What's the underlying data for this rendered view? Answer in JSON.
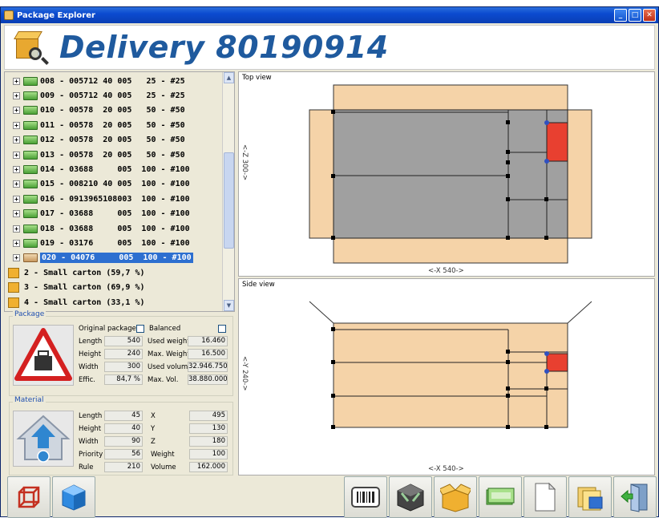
{
  "window": {
    "title": "Package Explorer"
  },
  "header": {
    "title": "Delivery 80190914"
  },
  "tree": {
    "items": [
      {
        "label": "008 - 005712 40 005   25 - #25",
        "kind": "bill"
      },
      {
        "label": "009 - 005712 40 005   25 - #25",
        "kind": "bill"
      },
      {
        "label": "010 - 00578  20 005   50 - #50",
        "kind": "bill"
      },
      {
        "label": "011 - 00578  20 005   50 - #50",
        "kind": "bill"
      },
      {
        "label": "012 - 00578  20 005   50 - #50",
        "kind": "bill"
      },
      {
        "label": "013 - 00578  20 005   50 - #50",
        "kind": "bill"
      },
      {
        "label": "014 - 03688     005  100 - #100",
        "kind": "bill"
      },
      {
        "label": "015 - 008210 40 005  100 - #100",
        "kind": "bill"
      },
      {
        "label": "016 - 0913965108003  100 - #100",
        "kind": "bill"
      },
      {
        "label": "017 - 03688     005  100 - #100",
        "kind": "bill"
      },
      {
        "label": "018 - 03688     005  100 - #100",
        "kind": "bill"
      },
      {
        "label": "019 - 03176     005  100 - #100",
        "kind": "bill"
      },
      {
        "label": "020 - 04076     005  100 - #100",
        "kind": "selected"
      },
      {
        "label": "2 - Small carton (59,7 %)",
        "kind": "carton"
      },
      {
        "label": "3 - Small carton (69,9 %)",
        "kind": "carton"
      },
      {
        "label": "4 - Small carton (33,1 %)",
        "kind": "carton"
      }
    ]
  },
  "package": {
    "group_label": "Package",
    "original_package_label": "Original package",
    "balanced_label": "Balanced",
    "length_label": "Length",
    "length": "540",
    "height_label": "Height",
    "height": "240",
    "width_label": "Width",
    "width": "300",
    "effic_label": "Effic.",
    "effic": "84,7 %",
    "used_weight_label": "Used weight",
    "used_weight": "16.460",
    "max_weight_label": "Max. Weight",
    "max_weight": "16.500",
    "used_volume_label": "Used volume",
    "used_volume": "32.946.750",
    "max_vol_label": "Max. Vol.",
    "max_vol": "38.880.000"
  },
  "material": {
    "group_label": "Material",
    "length_label": "Length",
    "length": "45",
    "height_label": "Height",
    "height": "40",
    "width_label": "Width",
    "width": "90",
    "priority_label": "Priority",
    "priority": "56",
    "rule_label": "Rule",
    "rule": "210",
    "x_label": "X",
    "x": "495",
    "y_label": "Y",
    "y": "130",
    "z_label": "Z",
    "z": "180",
    "weight_label": "Weight",
    "weight": "100",
    "volume_label": "Volume",
    "volume": "162.000"
  },
  "top_view": {
    "label": "Top view",
    "x_dim": "<-X 540->",
    "z_dim": "<-Z 300->"
  },
  "side_view": {
    "label": "Side view",
    "x_dim": "<-X 540->",
    "y_dim": "<-Y 240->"
  },
  "toolbar_left": [
    "3d-structure-icon",
    "blue-cube-icon"
  ],
  "toolbar_right": [
    "barcode-icon",
    "dark-box-icon",
    "open-box-icon",
    "money-icon",
    "document-icon",
    "folders-icon",
    "exit-door-icon"
  ],
  "colors": {
    "accent": "#1f5a9e",
    "carton": "#f5d3a8",
    "load": "#a0a0a0",
    "selected": "#e84030"
  }
}
